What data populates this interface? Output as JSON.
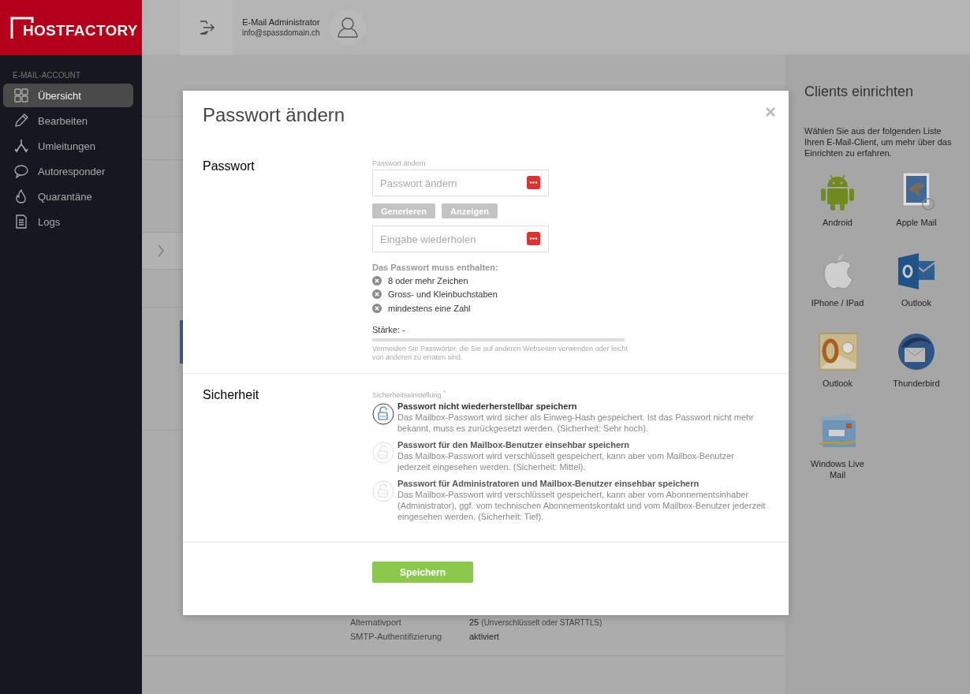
{
  "logo": {
    "text": "HOSTFACTORY"
  },
  "header": {
    "user_name": "E-Mail Administrator",
    "user_email": "info@spassdomain.ch"
  },
  "sidebar": {
    "section": "E-MAIL-ACCOUNT",
    "items": [
      {
        "label": "Übersicht",
        "kind": "grid",
        "selected": true
      },
      {
        "label": "Bearbeiten",
        "kind": "pencil",
        "selected": false
      },
      {
        "label": "Umleitungen",
        "kind": "fork",
        "selected": false
      },
      {
        "label": "Autoresponder",
        "kind": "chat",
        "selected": false
      },
      {
        "label": "Quarantäne",
        "kind": "flame",
        "selected": false
      },
      {
        "label": "Logs",
        "kind": "document",
        "selected": false
      }
    ]
  },
  "main": {
    "rows": [
      {
        "label": "Alternativport",
        "value": "25",
        "note": "(Unverschlüsselt oder STARTTLS)"
      },
      {
        "label": "SMTP-Authentifizierung",
        "value": "aktiviert"
      }
    ]
  },
  "clients_panel": {
    "title": "Clients einrichten",
    "description": "Wählen Sie aus der folgenden Liste Ihren E-Mail-Client, um mehr über das Einrichten zu erfahren.",
    "clients": [
      {
        "name": "Android",
        "kind": "android"
      },
      {
        "name": "Apple Mail",
        "kind": "stamp"
      },
      {
        "name": "IPhone / IPad",
        "kind": "apple"
      },
      {
        "name": "Outlook",
        "kind": "outlook"
      },
      {
        "name": "Outlook",
        "kind": "outlook_old"
      },
      {
        "name": "Thunderbird",
        "kind": "bird"
      },
      {
        "name": "Windows Live Mail",
        "kind": "envelopes"
      }
    ]
  },
  "modal": {
    "title": "Passwort ändern",
    "close": "×",
    "password_section": {
      "label": "Passwort",
      "fields": [
        {
          "label": "Passwort ändern",
          "placeholder": "Passwort ändern"
        },
        {
          "placeholder": "Eingabe wiederholen"
        }
      ],
      "buttons": [
        "Generieren",
        "Anzeigen"
      ],
      "requirements_title": "Das Passwort muss enthalten:",
      "requirements": [
        {
          "text": "8 oder mehr Zeichen",
          "met": false
        },
        {
          "text": "Gross- und Kleinbuchstaben",
          "met": false
        },
        {
          "text": "mindestens eine Zahl",
          "met": false
        }
      ],
      "strength_label": "Stärke: -",
      "strength": {
        "level": 0
      },
      "hint": "Vermeiden Sie Passwörter, die Sie auf anderen Webseiten verwenden oder leicht von anderen zu erraten sind."
    },
    "security_section": {
      "label": "Sicherheit",
      "field_label": "Sicherheitseinstellung $^{*}$",
      "options": [
        {
          "title": "Passwort nicht wiederherstellbar speichern",
          "description": "Das Mailbox-Passwort wird sicher als Einweg-Hash gespeichert. Ist das Passwort nicht mehr bekannt, muss es zurückgesetzt werden. (Sicherheit: Sehr hoch).",
          "selected": true
        },
        {
          "title": "Passwort für den Mailbox-Benutzer einsehbar speichern",
          "description": "Das Mailbox-Passwort wird verschlüsselt gespeichert, kann aber vom Mailbox-Benutzer jederzeit eingesehen werden. (Sicherheit: Mittel).",
          "selected": false
        },
        {
          "title": "Passwort für Administratoren und Mailbox-Benutzer einsehbar speichern",
          "description": "Das Mailbox-Passwort wird verschlüsselt gespeichert, kann aber vom Abonnementsinhaber (Administrator), ggf. vom technischen Abonnementskontakt und vom Mailbox-Benutzer jederzeit eingesehen werden. (Sicherheit: Tief).",
          "selected": false
        }
      ]
    },
    "save_button": "Speichern"
  }
}
